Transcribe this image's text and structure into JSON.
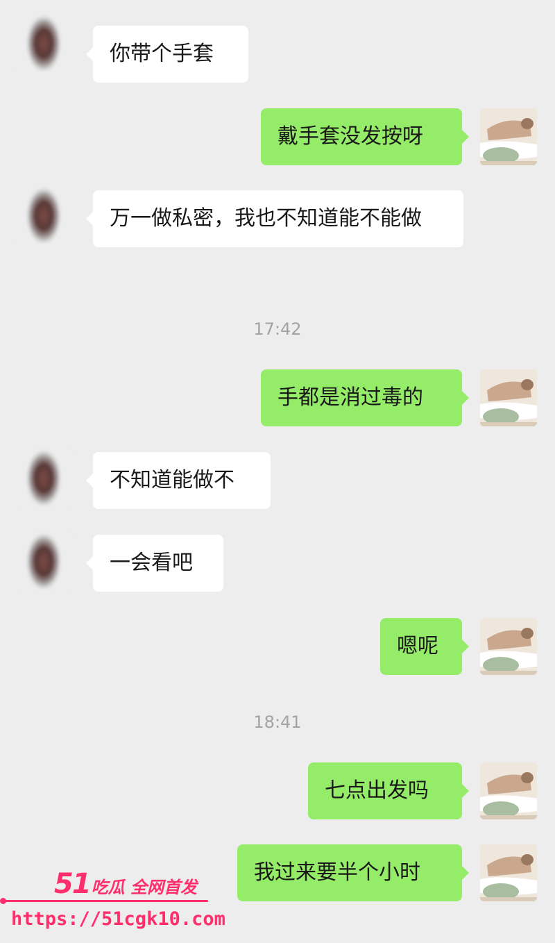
{
  "messages": [
    {
      "side": "left",
      "text": "你带个手套"
    },
    {
      "side": "right",
      "text": "戴手套没发按呀"
    },
    {
      "side": "left",
      "text": "万一做私密，我也不知道能不能做"
    },
    {
      "side": "right",
      "text": "手都是消过毒的"
    },
    {
      "side": "left",
      "text": "不知道能做不"
    },
    {
      "side": "left",
      "text": "一会看吧"
    },
    {
      "side": "right",
      "text": "嗯呢"
    },
    {
      "side": "right",
      "text": "七点出发吗"
    },
    {
      "side": "right",
      "text": "我过来要半个小时"
    }
  ],
  "timestamps": [
    "17:42",
    "18:41"
  ],
  "watermark": {
    "logo_number": "51",
    "logo_text": "吃瓜 全网首发",
    "url": "https://51cgk10.com"
  },
  "icons": {
    "left_avatar": "blurred-contact-avatar",
    "right_avatar": "massage-photo-avatar"
  },
  "colors": {
    "background": "#ededed",
    "incoming_bubble": "#ffffff",
    "outgoing_bubble": "#95ec69",
    "timestamp": "#a3a3a3",
    "watermark": "#ff2d6b"
  }
}
